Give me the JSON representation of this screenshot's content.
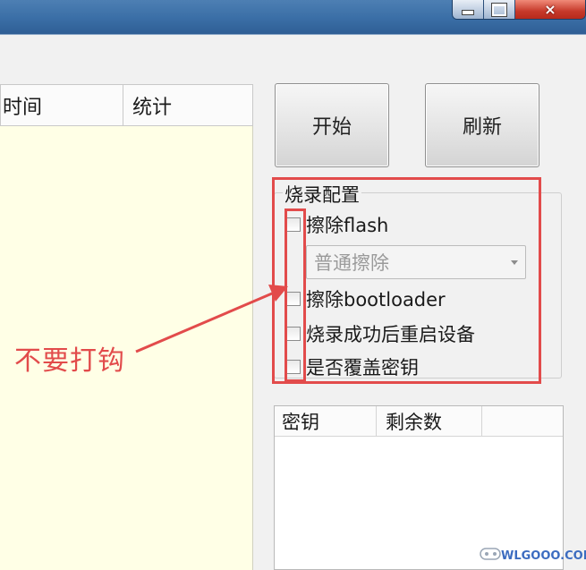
{
  "window_controls": {
    "minimize": "minimize",
    "maximize": "maximize",
    "close": "×"
  },
  "log_table": {
    "columns": [
      "时间",
      "统计"
    ]
  },
  "buttons": {
    "start": "开始",
    "refresh": "刷新"
  },
  "config": {
    "title": "烧录配置",
    "erase_flash": {
      "label": "擦除flash",
      "checked": false
    },
    "erase_mode": {
      "value": "普通擦除"
    },
    "erase_bootloader": {
      "label": "擦除bootloader",
      "checked": false
    },
    "reboot_after": {
      "label": "烧录成功后重启设备",
      "checked": false
    },
    "overwrite_key": {
      "label": "是否覆盖密钥",
      "checked": false
    }
  },
  "annotation": {
    "text": "不要打钩",
    "color": "#e24b4b"
  },
  "key_table": {
    "columns": [
      "密钥",
      "剩余数"
    ]
  },
  "watermark": {
    "text": "WLGOOO.COM"
  }
}
